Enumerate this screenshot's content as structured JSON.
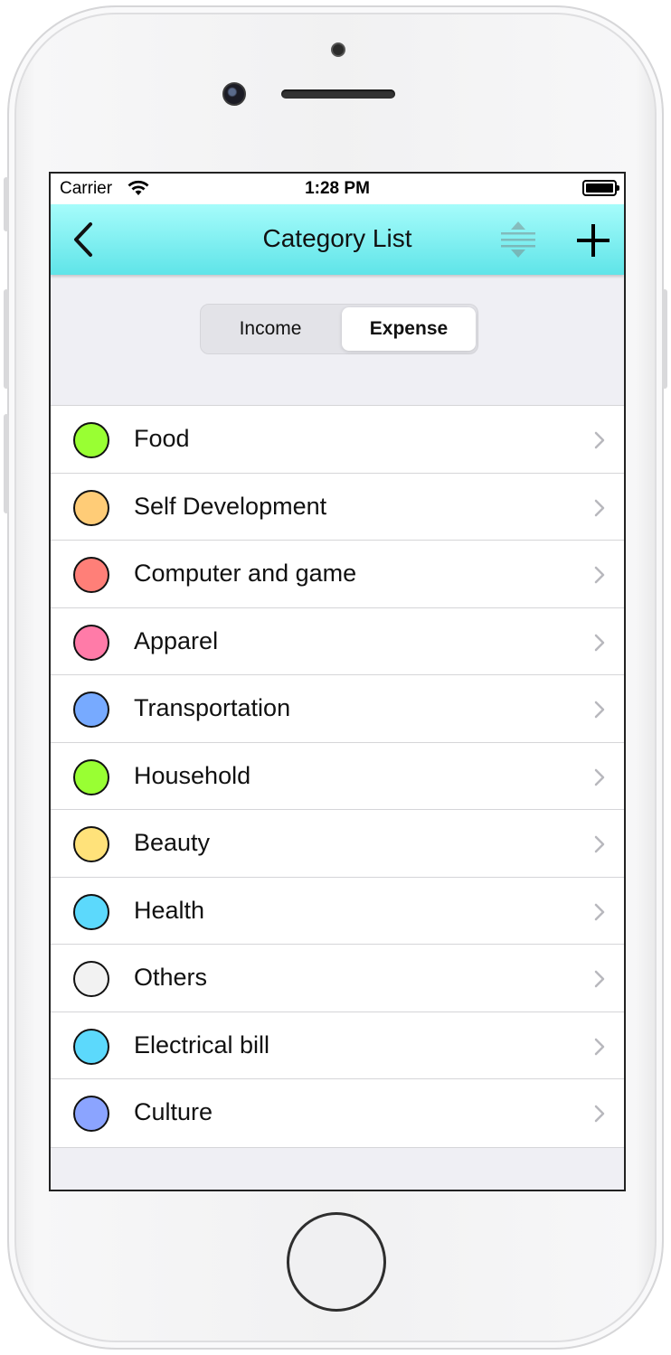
{
  "status_bar": {
    "carrier": "Carrier",
    "time": "1:28 PM"
  },
  "nav": {
    "title": "Category List",
    "back_icon": "chevron-left-icon",
    "sort_icon": "sort-icon",
    "add_icon": "plus-icon"
  },
  "segment": {
    "income_label": "Income",
    "expense_label": "Expense",
    "selected": "Expense"
  },
  "categories": [
    {
      "label": "Food",
      "color": "#99ff33"
    },
    {
      "label": "Self Development",
      "color": "#ffcc77"
    },
    {
      "label": "Computer and game",
      "color": "#ff7f78"
    },
    {
      "label": "Apparel",
      "color": "#ff7ba8"
    },
    {
      "label": "Transportation",
      "color": "#77aaff"
    },
    {
      "label": "Household",
      "color": "#99ff33"
    },
    {
      "label": "Beauty",
      "color": "#ffe27a"
    },
    {
      "label": "Health",
      "color": "#5cd9fc"
    },
    {
      "label": "Others",
      "color": "#f2f2f2"
    },
    {
      "label": "Electrical bill",
      "color": "#5cd9fc"
    },
    {
      "label": "Culture",
      "color": "#8ba4ff"
    }
  ],
  "colors": {
    "nav_top": "#a6fcfb",
    "nav_bottom": "#5fe4e8",
    "background": "#efeff4"
  }
}
